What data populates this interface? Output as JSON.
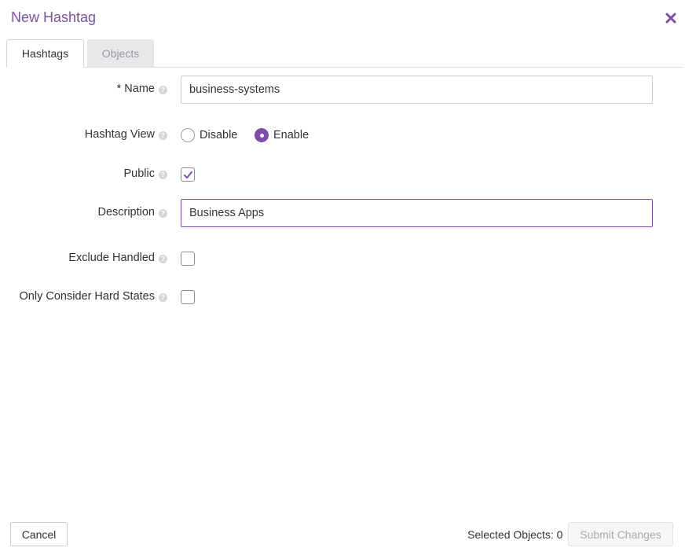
{
  "dialog": {
    "title": "New Hashtag",
    "close_icon": "close-x-icon",
    "accent_color": "#7b4fa8"
  },
  "tabs": [
    {
      "label": "Hashtags",
      "active": true
    },
    {
      "label": "Objects",
      "active": false
    }
  ],
  "form": {
    "name": {
      "label": "* Name",
      "value": "business-systems"
    },
    "hashtag_view": {
      "label": "Hashtag View",
      "options": [
        {
          "label": "Disable",
          "checked": false
        },
        {
          "label": "Enable",
          "checked": true
        }
      ]
    },
    "public": {
      "label": "Public",
      "checked": true
    },
    "description": {
      "label": "Description",
      "value": "Business Apps"
    },
    "exclude_handled": {
      "label": "Exclude Handled",
      "checked": false
    },
    "only_hard_states": {
      "label": "Only Consider Hard States",
      "checked": false
    },
    "help_glyph": "?"
  },
  "footer": {
    "cancel_label": "Cancel",
    "selected_objects": "Selected Objects: 0",
    "submit_label": "Submit Changes",
    "submit_enabled": false
  }
}
